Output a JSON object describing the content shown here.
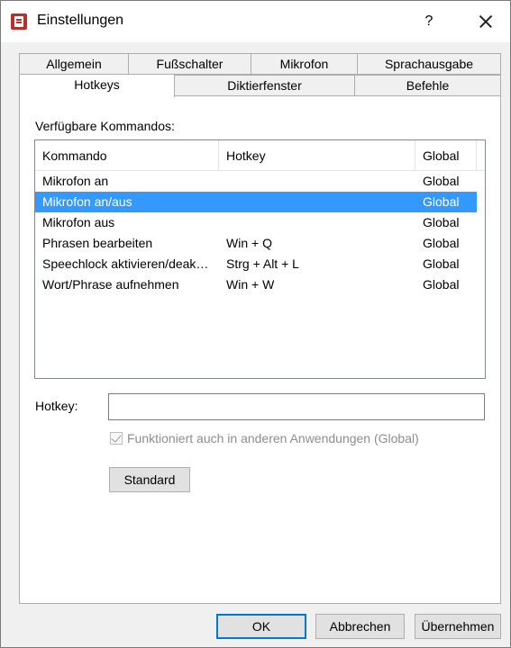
{
  "window": {
    "title": "Einstellungen",
    "help": "?"
  },
  "tabs": {
    "row1": [
      "Allgemein",
      "Fußschalter",
      "Mikrofon",
      "Sprachausgabe"
    ],
    "row2": [
      "Hotkeys",
      "Diktierfenster",
      "Befehle"
    ],
    "active": "Hotkeys"
  },
  "commands": {
    "label": "Verfügbare Kommandos:",
    "columns": [
      "Kommando",
      "Hotkey",
      "Global"
    ],
    "rows": [
      {
        "command": "Mikrofon an",
        "hotkey": "",
        "global": "Global",
        "selected": false
      },
      {
        "command": "Mikrofon an/aus",
        "hotkey": "",
        "global": "Global",
        "selected": true
      },
      {
        "command": "Mikrofon aus",
        "hotkey": "",
        "global": "Global",
        "selected": false
      },
      {
        "command": "Phrasen bearbeiten",
        "hotkey": "Win + Q",
        "global": "Global",
        "selected": false
      },
      {
        "command": "Speechlock aktivieren/deak…",
        "hotkey": "Strg + Alt + L",
        "global": "Global",
        "selected": false
      },
      {
        "command": "Wort/Phrase aufnehmen",
        "hotkey": "Win + W",
        "global": "Global",
        "selected": false
      }
    ]
  },
  "hotkey": {
    "label": "Hotkey:",
    "value": ""
  },
  "global_option": {
    "label": "Funktioniert auch in anderen Anwendungen (Global)",
    "checked": true,
    "enabled": false
  },
  "buttons": {
    "standard": "Standard",
    "ok": "OK",
    "cancel": "Abbrechen",
    "apply": "Übernehmen"
  },
  "colors": {
    "selection": "#3399ff",
    "default_button_border": "#0078d7"
  }
}
